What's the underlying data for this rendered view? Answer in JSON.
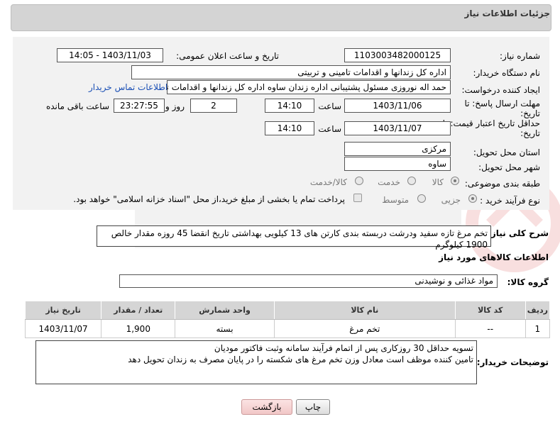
{
  "header": {
    "title": "جزئیات اطلاعات نیاز"
  },
  "form": {
    "need_number_label": "شماره نیاز:",
    "need_number": "1103003482000125",
    "announce_label": "تاریخ و ساعت اعلان عمومی:",
    "announce_value": "1403/11/03 - 14:05",
    "buyer_org_label": "نام دستگاه خریدار:",
    "buyer_org": "اداره کل زندانها و اقدامات تامینی و تربیتی",
    "requester_label": "ایجاد کننده درخواست:",
    "requester": "حمد اله نوروزی مسئول پشتیبانی اداره زندان ساوه اداره کل زندانها و اقدامات تام",
    "contact_link": "اطلاعات تماس خریدار",
    "deadline_label_1": "مهلت ارسال پاسخ: تا",
    "deadline_label_2": "تاریخ:",
    "deadline_date": "1403/11/06",
    "time_label": "ساعت",
    "deadline_time": "14:10",
    "days_value": "2",
    "days_label": "روز و",
    "remaining_time": "23:27:55",
    "remaining_label": "ساعت باقی مانده",
    "validity_label_1": "حداقل تاریخ اعتبار قیمت: تا",
    "validity_label_2": "تاریخ:",
    "validity_date": "1403/11/07",
    "validity_time": "14:10",
    "province_label": "استان محل تحویل:",
    "province": "مرکزی",
    "city_label": "شهر محل تحویل:",
    "city": "ساوه",
    "category_label": "طبقه بندی موضوعی:",
    "category_options": [
      "کالا",
      "خدمت",
      "کالا/خدمت"
    ],
    "category_selected": "کالا",
    "process_label": "نوع فرآیند خرید :",
    "process_options": [
      "جزیی",
      "متوسط"
    ],
    "process_selected": "جزیی",
    "payment_note": "پرداخت تمام یا بخشی از مبلغ خرید،از محل \"اسناد خزانه اسلامی\" خواهد بود."
  },
  "description": {
    "label": "شرح کلی نیاز:",
    "text": "تخم مرغ تازه سفید ودرشت دربسته بندی کارتن های 13 کیلویی بهداشتی تاریخ انقضا 45 روزه مقدار خالص 1900 کیلوگرم"
  },
  "goods": {
    "section_title": "اطلاعات کالاهای مورد نیاز",
    "group_label": "گروه کالا:",
    "group_value": "مواد غذائی و نوشیدنی",
    "columns": [
      "ردیف",
      "کد کالا",
      "نام کالا",
      "واحد شمارش",
      "تعداد / مقدار",
      "تاریخ نیاز"
    ],
    "rows": [
      {
        "row": "1",
        "code": "--",
        "name": "تخم مرغ",
        "unit": "بسته",
        "qty": "1,900",
        "date": "1403/11/07"
      }
    ]
  },
  "buyer_notes": {
    "label": "توضیحات خریدار:",
    "line1": "تسویه حداقل 30 روزکاری پس از اتمام فرآیند سامانه وثبت فاکتور مودیان",
    "line2": "تامین کننده موظف است معادل وزن تخم مرغ های شکسته را در پایان مصرف به زندان تحویل دهد"
  },
  "buttons": {
    "print": "چاپ",
    "back": "بازگشت"
  },
  "colors": {
    "header_bg": "#d4d4d4",
    "panel_bg": "#f2f2f2",
    "link": "#1a4fb5",
    "back_button": "#f1c7c7"
  }
}
